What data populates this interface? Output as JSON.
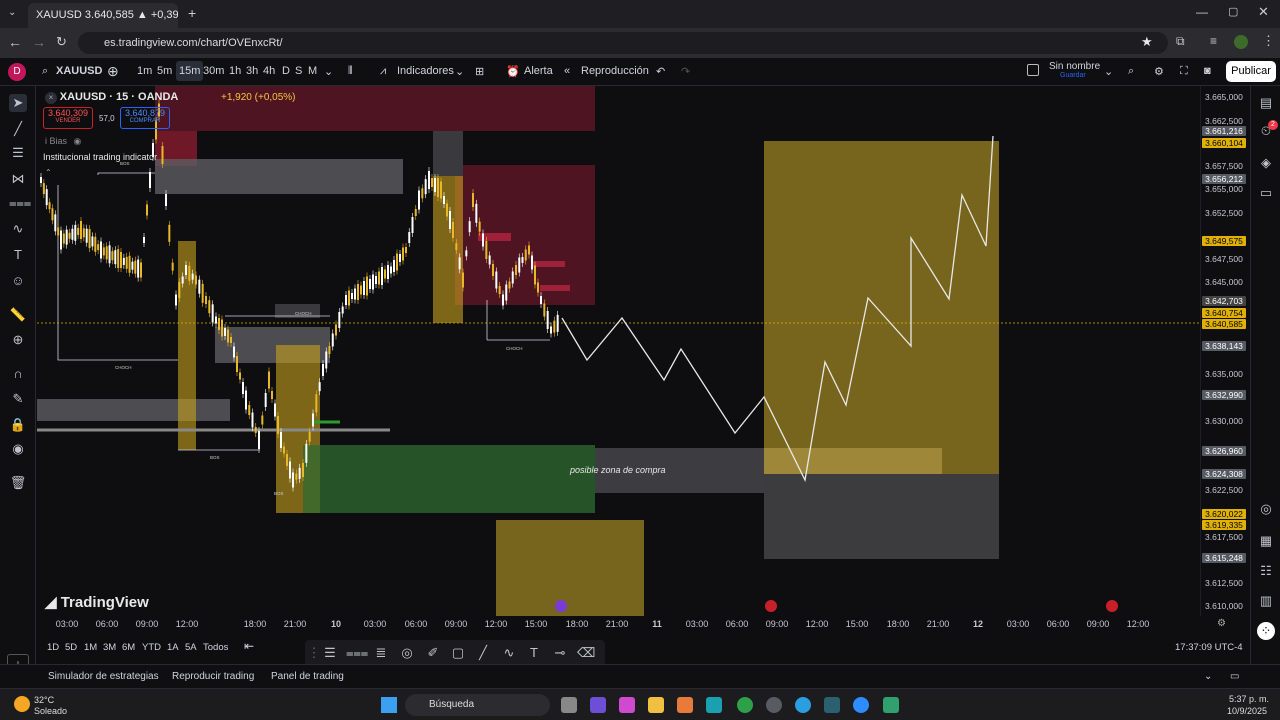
{
  "browser": {
    "tab_title": "XAUUSD 3.640,585 ▲ +0,39% S",
    "url": "es.tradingview.com/chart/OVEnxcRt/"
  },
  "toolbar": {
    "avatar_letter": "D",
    "symbol": "XAUUSD",
    "intervals": [
      "1m",
      "5m",
      "15m",
      "30m",
      "1h",
      "3h",
      "4h",
      "D",
      "S",
      "M"
    ],
    "active_interval": "15m",
    "indicators_label": "Indicadores",
    "alert_label": "Alerta",
    "replay_label": "Reproducción",
    "layout_name": "Sin nombre",
    "layout_save": "Guardar",
    "publish_label": "Publicar"
  },
  "legend": {
    "title": "XAUUSD · 15 · OANDA",
    "change": "+1,920 (+0,05%)",
    "sell_price": "3.640,309",
    "sell_label": "VENDER",
    "spread": "57,0",
    "buy_price": "3.640,879",
    "buy_label": "COMPRAR",
    "bias_label": "i Bias",
    "indicator_name": "Institucional trading indicator"
  },
  "chart_annotations": {
    "zone_label": "posible zona de compra",
    "choch": "CHOCH",
    "bos": "BOS",
    "watermark": "TradingView"
  },
  "price_axis": {
    "labels": [
      "3.665,000",
      "3.662,500",
      "3.657,500",
      "3.655,000",
      "3.652,500",
      "3.647,500",
      "3.645,000",
      "3.635,000",
      "3.630,000",
      "3.622,500",
      "3.617,500",
      "3.612,500",
      "3.610,000"
    ],
    "badges": [
      {
        "text": "3.661,216",
        "color": "#555a63"
      },
      {
        "text": "3.660,104",
        "color": "#e0b100"
      },
      {
        "text": "3.656,212",
        "color": "#555a63"
      },
      {
        "text": "3.649,575",
        "color": "#e0b100"
      },
      {
        "text": "3.642,703",
        "color": "#444"
      },
      {
        "text": "3.640,754",
        "color": "#e0b100"
      },
      {
        "text": "3.640,585",
        "color": "#e0b100"
      },
      {
        "text": "3.638,143",
        "color": "#555a63"
      },
      {
        "text": "3.632,990",
        "color": "#555a63"
      },
      {
        "text": "3.626,960",
        "color": "#555a63"
      },
      {
        "text": "3.624,308",
        "color": "#555a63"
      },
      {
        "text": "3.620,022",
        "color": "#e0b100"
      },
      {
        "text": "3.619,335",
        "color": "#e0b100"
      },
      {
        "text": "3.615,248",
        "color": "#555a63"
      }
    ]
  },
  "time_axis": [
    "03:00",
    "06:00",
    "09:00",
    "12:00",
    "18:00",
    "21:00",
    "10",
    "03:00",
    "06:00",
    "09:00",
    "12:00",
    "15:00",
    "18:00",
    "21:00",
    "11",
    "03:00",
    "06:00",
    "09:00",
    "12:00",
    "15:00",
    "18:00",
    "21:00",
    "12",
    "03:00",
    "06:00",
    "09:00",
    "12:00"
  ],
  "range_bar": {
    "ranges": [
      "1D",
      "5D",
      "1M",
      "3M",
      "6M",
      "YTD",
      "1A",
      "5A",
      "Todos"
    ],
    "clock": "17:37:09 UTC-4"
  },
  "bottom_panel": {
    "tabs": [
      "Simulador de estrategias",
      "Reproducir trading",
      "Panel de trading"
    ]
  },
  "taskbar": {
    "weather_temp": "32°C",
    "weather_desc": "Soleado",
    "search_label": "Búsqueda",
    "time": "5:37 p. m.",
    "date": "10/9/2025"
  },
  "colors": {
    "bull": "#e8b828",
    "bear": "#ffffff",
    "supply_zone": "#7a1a2a",
    "demand_zone": "#2f6b2f",
    "target_box": "#8a7420",
    "accent": "#2962ff"
  }
}
